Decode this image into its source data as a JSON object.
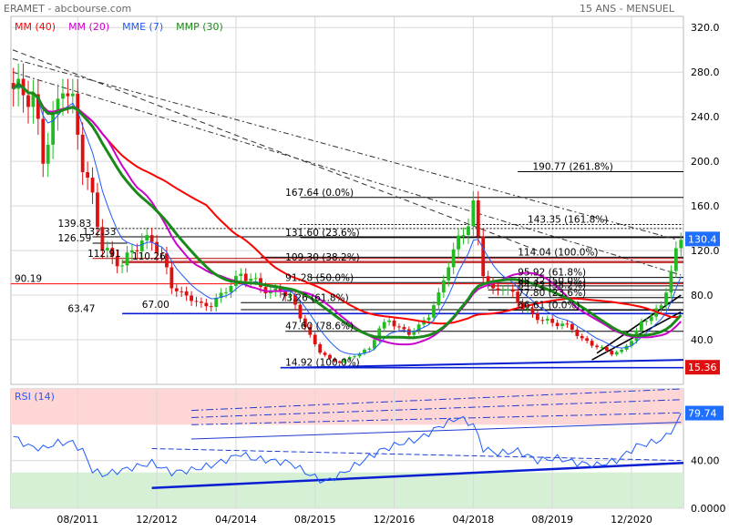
{
  "header": {
    "title": "ERAMET - abcbourse.com",
    "period": "15 ANS - MENSUEL"
  },
  "legend": [
    {
      "label": "MM (40)",
      "color": "#ff0000"
    },
    {
      "label": "MM (20)",
      "color": "#cc00cc"
    },
    {
      "label": "MME (7)",
      "color": "#1e5bff"
    },
    {
      "label": "MMP (30)",
      "color": "#1a8a1a"
    }
  ],
  "colors": {
    "up_candle": "#22bb22",
    "down_candle": "#dd1111",
    "mm40": "#ff0000",
    "mm20": "#cc00cc",
    "mme7": "#1e5bff",
    "mmp30": "#1a8a1a",
    "trend_blue": "#0a1fd1",
    "rsi_line": "#1e5bff",
    "rsi_overbought_zone": "#ffd6d6",
    "rsi_oversold_zone": "#d6f0d6",
    "price_badge": "#1e6fff",
    "low_badge": "#dd1111"
  },
  "chart_data": [
    {
      "type": "candlestick",
      "panel": "price",
      "title": "",
      "xlabel": "",
      "ylabel": "",
      "ylim": [
        0,
        330
      ],
      "yticks": [
        "320.0",
        "280.0",
        "240.0",
        "200.0",
        "160.0",
        "120.0",
        "80.0",
        "40.0"
      ],
      "ytick_values": [
        320,
        280,
        240,
        200,
        160,
        120,
        80,
        40
      ],
      "xticks": [
        "08/2011",
        "12/2012",
        "04/2014",
        "08/2015",
        "12/2016",
        "04/2018",
        "08/2019",
        "12/2020"
      ],
      "xtick_month_index": [
        13,
        29,
        45,
        61,
        77,
        93,
        109,
        125
      ],
      "x_start": "2010-07",
      "months": 136,
      "candles_keypoints": [
        [
          0,
          265
        ],
        [
          2,
          262
        ],
        [
          4,
          255
        ],
        [
          6,
          205
        ],
        [
          8,
          235
        ],
        [
          10,
          270
        ],
        [
          12,
          250
        ],
        [
          14,
          200
        ],
        [
          16,
          165
        ],
        [
          18,
          125
        ],
        [
          20,
          112
        ],
        [
          22,
          108
        ],
        [
          24,
          120
        ],
        [
          26,
          128
        ],
        [
          28,
          130
        ],
        [
          30,
          114
        ],
        [
          32,
          90
        ],
        [
          34,
          80
        ],
        [
          36,
          78
        ],
        [
          38,
          70
        ],
        [
          40,
          72
        ],
        [
          42,
          80
        ],
        [
          44,
          90
        ],
        [
          46,
          98
        ],
        [
          48,
          95
        ],
        [
          50,
          88
        ],
        [
          52,
          82
        ],
        [
          54,
          85
        ],
        [
          56,
          78
        ],
        [
          58,
          62
        ],
        [
          60,
          42
        ],
        [
          62,
          30
        ],
        [
          64,
          22
        ],
        [
          66,
          20
        ],
        [
          68,
          24
        ],
        [
          70,
          28
        ],
        [
          72,
          32
        ],
        [
          74,
          50
        ],
        [
          76,
          58
        ],
        [
          78,
          50
        ],
        [
          80,
          46
        ],
        [
          82,
          52
        ],
        [
          84,
          62
        ],
        [
          86,
          80
        ],
        [
          88,
          108
        ],
        [
          90,
          130
        ],
        [
          92,
          145
        ],
        [
          93,
          160
        ],
        [
          94,
          130
        ],
        [
          95,
          102
        ],
        [
          97,
          82
        ],
        [
          99,
          88
        ],
        [
          101,
          80
        ],
        [
          103,
          70
        ],
        [
          105,
          62
        ],
        [
          107,
          58
        ],
        [
          109,
          55
        ],
        [
          111,
          54
        ],
        [
          113,
          50
        ],
        [
          115,
          40
        ],
        [
          117,
          36
        ],
        [
          119,
          32
        ],
        [
          121,
          28
        ],
        [
          123,
          30
        ],
        [
          125,
          40
        ],
        [
          127,
          55
        ],
        [
          129,
          62
        ],
        [
          131,
          70
        ],
        [
          132,
          85
        ],
        [
          133,
          102
        ],
        [
          134,
          118
        ],
        [
          135,
          130.4
        ]
      ],
      "series": [
        {
          "name": "MM (40)",
          "color": "#ff0000"
        },
        {
          "name": "MM (20)",
          "color": "#cc00cc"
        },
        {
          "name": "MME (7)",
          "color": "#1e5bff"
        },
        {
          "name": "MMP (30)",
          "color": "#1a8a1a"
        }
      ],
      "annotations": [
        {
          "text": "139.83",
          "value": 139.83
        },
        {
          "text": "132.33",
          "value": 132.33
        },
        {
          "text": "126.59",
          "value": 126.59
        },
        {
          "text": "112.91",
          "value": 112.91
        },
        {
          "text": "110.26",
          "value": 110.26
        },
        {
          "text": "90.19",
          "value": 90.19
        },
        {
          "text": "63.47",
          "value": 63.47
        },
        {
          "text": "67.00",
          "value": 67.0
        },
        {
          "text": "167.64  (0.0%)",
          "value": 167.64
        },
        {
          "text": "131.60  (23.6%)",
          "value": 131.6
        },
        {
          "text": "109.30  (38.2%)",
          "value": 109.3
        },
        {
          "text": "91.28  (50.0%)",
          "value": 91.28
        },
        {
          "text": "73.26  (61.8%)",
          "value": 73.26
        },
        {
          "text": "47.60  (78.6%)",
          "value": 47.6
        },
        {
          "text": "14.92  (100.0%)",
          "value": 14.92
        },
        {
          "text": "190.77  (261.8%)",
          "value": 190.77
        },
        {
          "text": "143.35  (161.8%)",
          "value": 143.35
        },
        {
          "text": "114.04  (100.0%)",
          "value": 114.04
        },
        {
          "text": "95.92  (61.8%)",
          "value": 95.92
        },
        {
          "text": "88.32  (50.0%)",
          "value": 88.32
        },
        {
          "text": "84.72  (38.2%)",
          "value": 84.72
        },
        {
          "text": "77.80  (23.6%)",
          "value": 77.8
        },
        {
          "text": "66.61  (0.0%)",
          "value": 66.61
        }
      ],
      "last_price": "130.4",
      "low_price": "15.36"
    },
    {
      "type": "line",
      "panel": "rsi",
      "title": "RSI (14)",
      "ylim": [
        0,
        100
      ],
      "yticks": [
        "79.74",
        "40.00",
        "0.0000"
      ],
      "ytick_values": [
        79.74,
        40,
        0
      ],
      "overbought": 70,
      "oversold": 30,
      "last_value": "79.74",
      "values_keypoints": [
        [
          0,
          60
        ],
        [
          3,
          52
        ],
        [
          6,
          50
        ],
        [
          9,
          55
        ],
        [
          12,
          55
        ],
        [
          14,
          48
        ],
        [
          16,
          32
        ],
        [
          18,
          28
        ],
        [
          20,
          30
        ],
        [
          24,
          34
        ],
        [
          28,
          38
        ],
        [
          32,
          30
        ],
        [
          36,
          32
        ],
        [
          40,
          36
        ],
        [
          44,
          42
        ],
        [
          46,
          46
        ],
        [
          48,
          42
        ],
        [
          52,
          40
        ],
        [
          56,
          38
        ],
        [
          60,
          28
        ],
        [
          63,
          22
        ],
        [
          66,
          28
        ],
        [
          70,
          38
        ],
        [
          74,
          48
        ],
        [
          78,
          54
        ],
        [
          82,
          58
        ],
        [
          86,
          68
        ],
        [
          90,
          76
        ],
        [
          93,
          70
        ],
        [
          95,
          50
        ],
        [
          98,
          46
        ],
        [
          102,
          48
        ],
        [
          106,
          40
        ],
        [
          110,
          42
        ],
        [
          114,
          38
        ],
        [
          118,
          36
        ],
        [
          122,
          40
        ],
        [
          126,
          52
        ],
        [
          130,
          56
        ],
        [
          132,
          60
        ],
        [
          134,
          70
        ],
        [
          135,
          79.74
        ]
      ]
    }
  ]
}
